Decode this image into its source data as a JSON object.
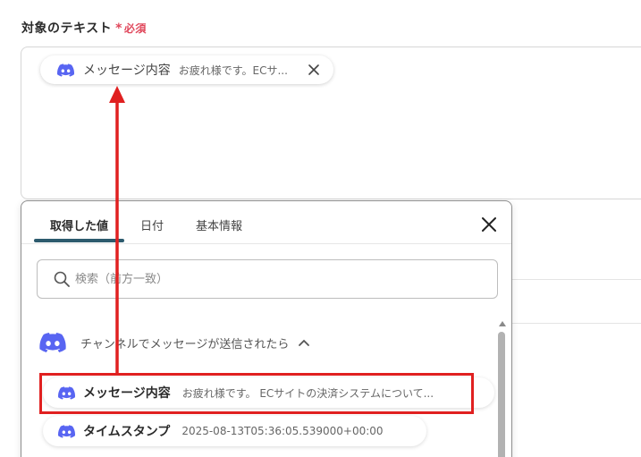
{
  "field": {
    "label": "対象のテキスト",
    "required_star": "*",
    "required_text": "必須"
  },
  "chip": {
    "icon": "discord-icon",
    "title": "メッセージ内容",
    "preview": "お疲れ様です。ECサ...",
    "close_icon": "close-icon"
  },
  "panel": {
    "tabs": [
      {
        "label": "取得した値",
        "active": true
      },
      {
        "label": "日付",
        "active": false
      },
      {
        "label": "基本情報",
        "active": false
      }
    ],
    "close_icon": "close-icon",
    "search": {
      "placeholder": "検索（前方一致）",
      "icon": "search-icon"
    },
    "group": {
      "icon": "discord-icon",
      "label": "チャンネルでメッセージが送信されたら",
      "chevron": "chevron-up-icon"
    },
    "items": [
      {
        "title": "メッセージ内容",
        "preview": "お疲れ様です。 ECサイトの決済システムについて..."
      },
      {
        "title": "タイムスタンプ",
        "preview": "2025-08-13T05:36:05.539000+00:00"
      }
    ]
  },
  "colors": {
    "accent": "#2d5b6e",
    "discord": "#5865f2",
    "required": "#e0475b",
    "annotation": "#e02020"
  }
}
